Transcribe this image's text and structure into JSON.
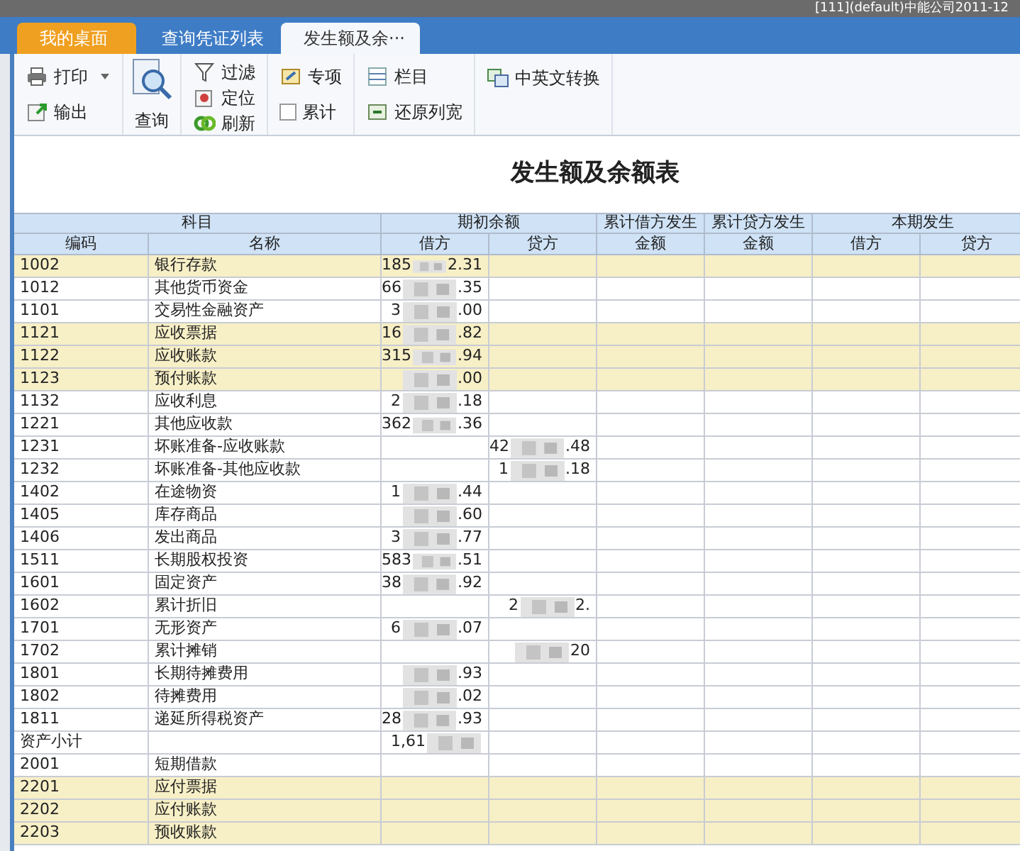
{
  "window": {
    "title": "[111](default)中能公司2011-12"
  },
  "tabs": [
    {
      "label": "我的桌面",
      "selected": false,
      "kind": "home"
    },
    {
      "label": "查询凭证列表",
      "selected": false,
      "kind": "plain"
    },
    {
      "label": "发生额及余···",
      "selected": true,
      "kind": "closable"
    }
  ],
  "toolbar": [
    {
      "kind": "stack",
      "items": [
        {
          "label": "打印",
          "kind": "button",
          "dropdown": true
        },
        {
          "label": "输出",
          "kind": "button"
        }
      ]
    },
    {
      "kind": "big",
      "label": "查询"
    },
    {
      "kind": "stack",
      "items": [
        {
          "label": "过滤",
          "kind": "button"
        },
        {
          "label": "定位",
          "kind": "button"
        },
        {
          "label": "刷新",
          "kind": "button"
        }
      ]
    },
    {
      "kind": "stack",
      "items": [
        {
          "label": "专项",
          "kind": "button"
        },
        {
          "label": "累计",
          "kind": "checkbox",
          "checked": false
        }
      ]
    },
    {
      "kind": "stack",
      "items": [
        {
          "label": "栏目",
          "kind": "button"
        },
        {
          "label": "还原列宽",
          "kind": "button"
        }
      ]
    },
    {
      "kind": "stack",
      "items": [
        {
          "label": "中英文转换",
          "kind": "button"
        }
      ]
    }
  ],
  "report": {
    "title": "发生额及余额表"
  },
  "table": {
    "groups": [
      "科目",
      "期初余额",
      "累计借方发生",
      "累计贷方发生",
      "本期发生"
    ],
    "columns": [
      "编码",
      "名称",
      "借方",
      "贷方",
      "金额",
      "金额",
      "借方",
      "贷方"
    ],
    "rows": [
      {
        "code": "1002",
        "name": "银行存款",
        "highlighted": true,
        "debit": {
          "start": "185",
          "end": "2.31"
        }
      },
      {
        "code": "1012",
        "name": "其他货币资金",
        "highlighted": false,
        "debit": {
          "start": "66",
          "end": ".35"
        }
      },
      {
        "code": "1101",
        "name": "交易性金融资产",
        "highlighted": false,
        "debit": {
          "start": "3",
          "end": ".00"
        }
      },
      {
        "code": "1121",
        "name": "应收票据",
        "highlighted": true,
        "debit": {
          "start": "16",
          "end": ".82"
        }
      },
      {
        "code": "1122",
        "name": "应收账款",
        "highlighted": true,
        "debit": {
          "start": "315",
          "end": ".94"
        }
      },
      {
        "code": "1123",
        "name": "预付账款",
        "highlighted": true,
        "debit": {
          "end": ".00"
        }
      },
      {
        "code": "1132",
        "name": "应收利息",
        "highlighted": false,
        "debit": {
          "start": "2",
          "end": ".18"
        }
      },
      {
        "code": "1221",
        "name": "其他应收款",
        "highlighted": false,
        "debit": {
          "start": "362",
          "end": ".36"
        }
      },
      {
        "code": "1231",
        "name": "坏账准备-应收账款",
        "highlighted": false,
        "credit": {
          "start": "42",
          "end": ".48"
        }
      },
      {
        "code": "1232",
        "name": "坏账准备-其他应收款",
        "highlighted": false,
        "credit": {
          "start": "1",
          "end": ".18"
        }
      },
      {
        "code": "1402",
        "name": "在途物资",
        "highlighted": false,
        "debit": {
          "start": "1",
          "end": ".44"
        }
      },
      {
        "code": "1405",
        "name": "库存商品",
        "highlighted": false,
        "debit": {
          "end": ".60"
        }
      },
      {
        "code": "1406",
        "name": "发出商品",
        "highlighted": false,
        "debit": {
          "start": "3",
          "end": ".77"
        }
      },
      {
        "code": "1511",
        "name": "长期股权投资",
        "highlighted": false,
        "debit": {
          "start": "583",
          "end": ".51"
        }
      },
      {
        "code": "1601",
        "name": "固定资产",
        "highlighted": false,
        "debit": {
          "start": "38",
          "end": ".92"
        }
      },
      {
        "code": "1602",
        "name": "累计折旧",
        "highlighted": false,
        "credit": {
          "start": "2",
          "end": "2."
        }
      },
      {
        "code": "1701",
        "name": "无形资产",
        "highlighted": false,
        "debit": {
          "start": "6",
          "end": ".07"
        }
      },
      {
        "code": "1702",
        "name": "累计摊销",
        "highlighted": false,
        "credit": {
          "end": "20"
        }
      },
      {
        "code": "1801",
        "name": "长期待摊费用",
        "highlighted": false,
        "debit": {
          "end": ".93"
        }
      },
      {
        "code": "1802",
        "name": "待摊费用",
        "highlighted": false,
        "debit": {
          "end": ".02"
        }
      },
      {
        "code": "1811",
        "name": "递延所得税资产",
        "highlighted": false,
        "debit": {
          "start": "28",
          "end": ".93"
        }
      },
      {
        "code": "资产小计",
        "highlighted": false,
        "debit": {
          "start": "1,61"
        }
      },
      {
        "code": "2001",
        "name": "短期借款",
        "highlighted": false
      },
      {
        "code": "2201",
        "name": "应付票据",
        "highlighted": true
      },
      {
        "code": "2202",
        "name": "应付账款",
        "highlighted": true
      },
      {
        "code": "2203",
        "name": "预收账款",
        "highlighted": true
      }
    ]
  }
}
